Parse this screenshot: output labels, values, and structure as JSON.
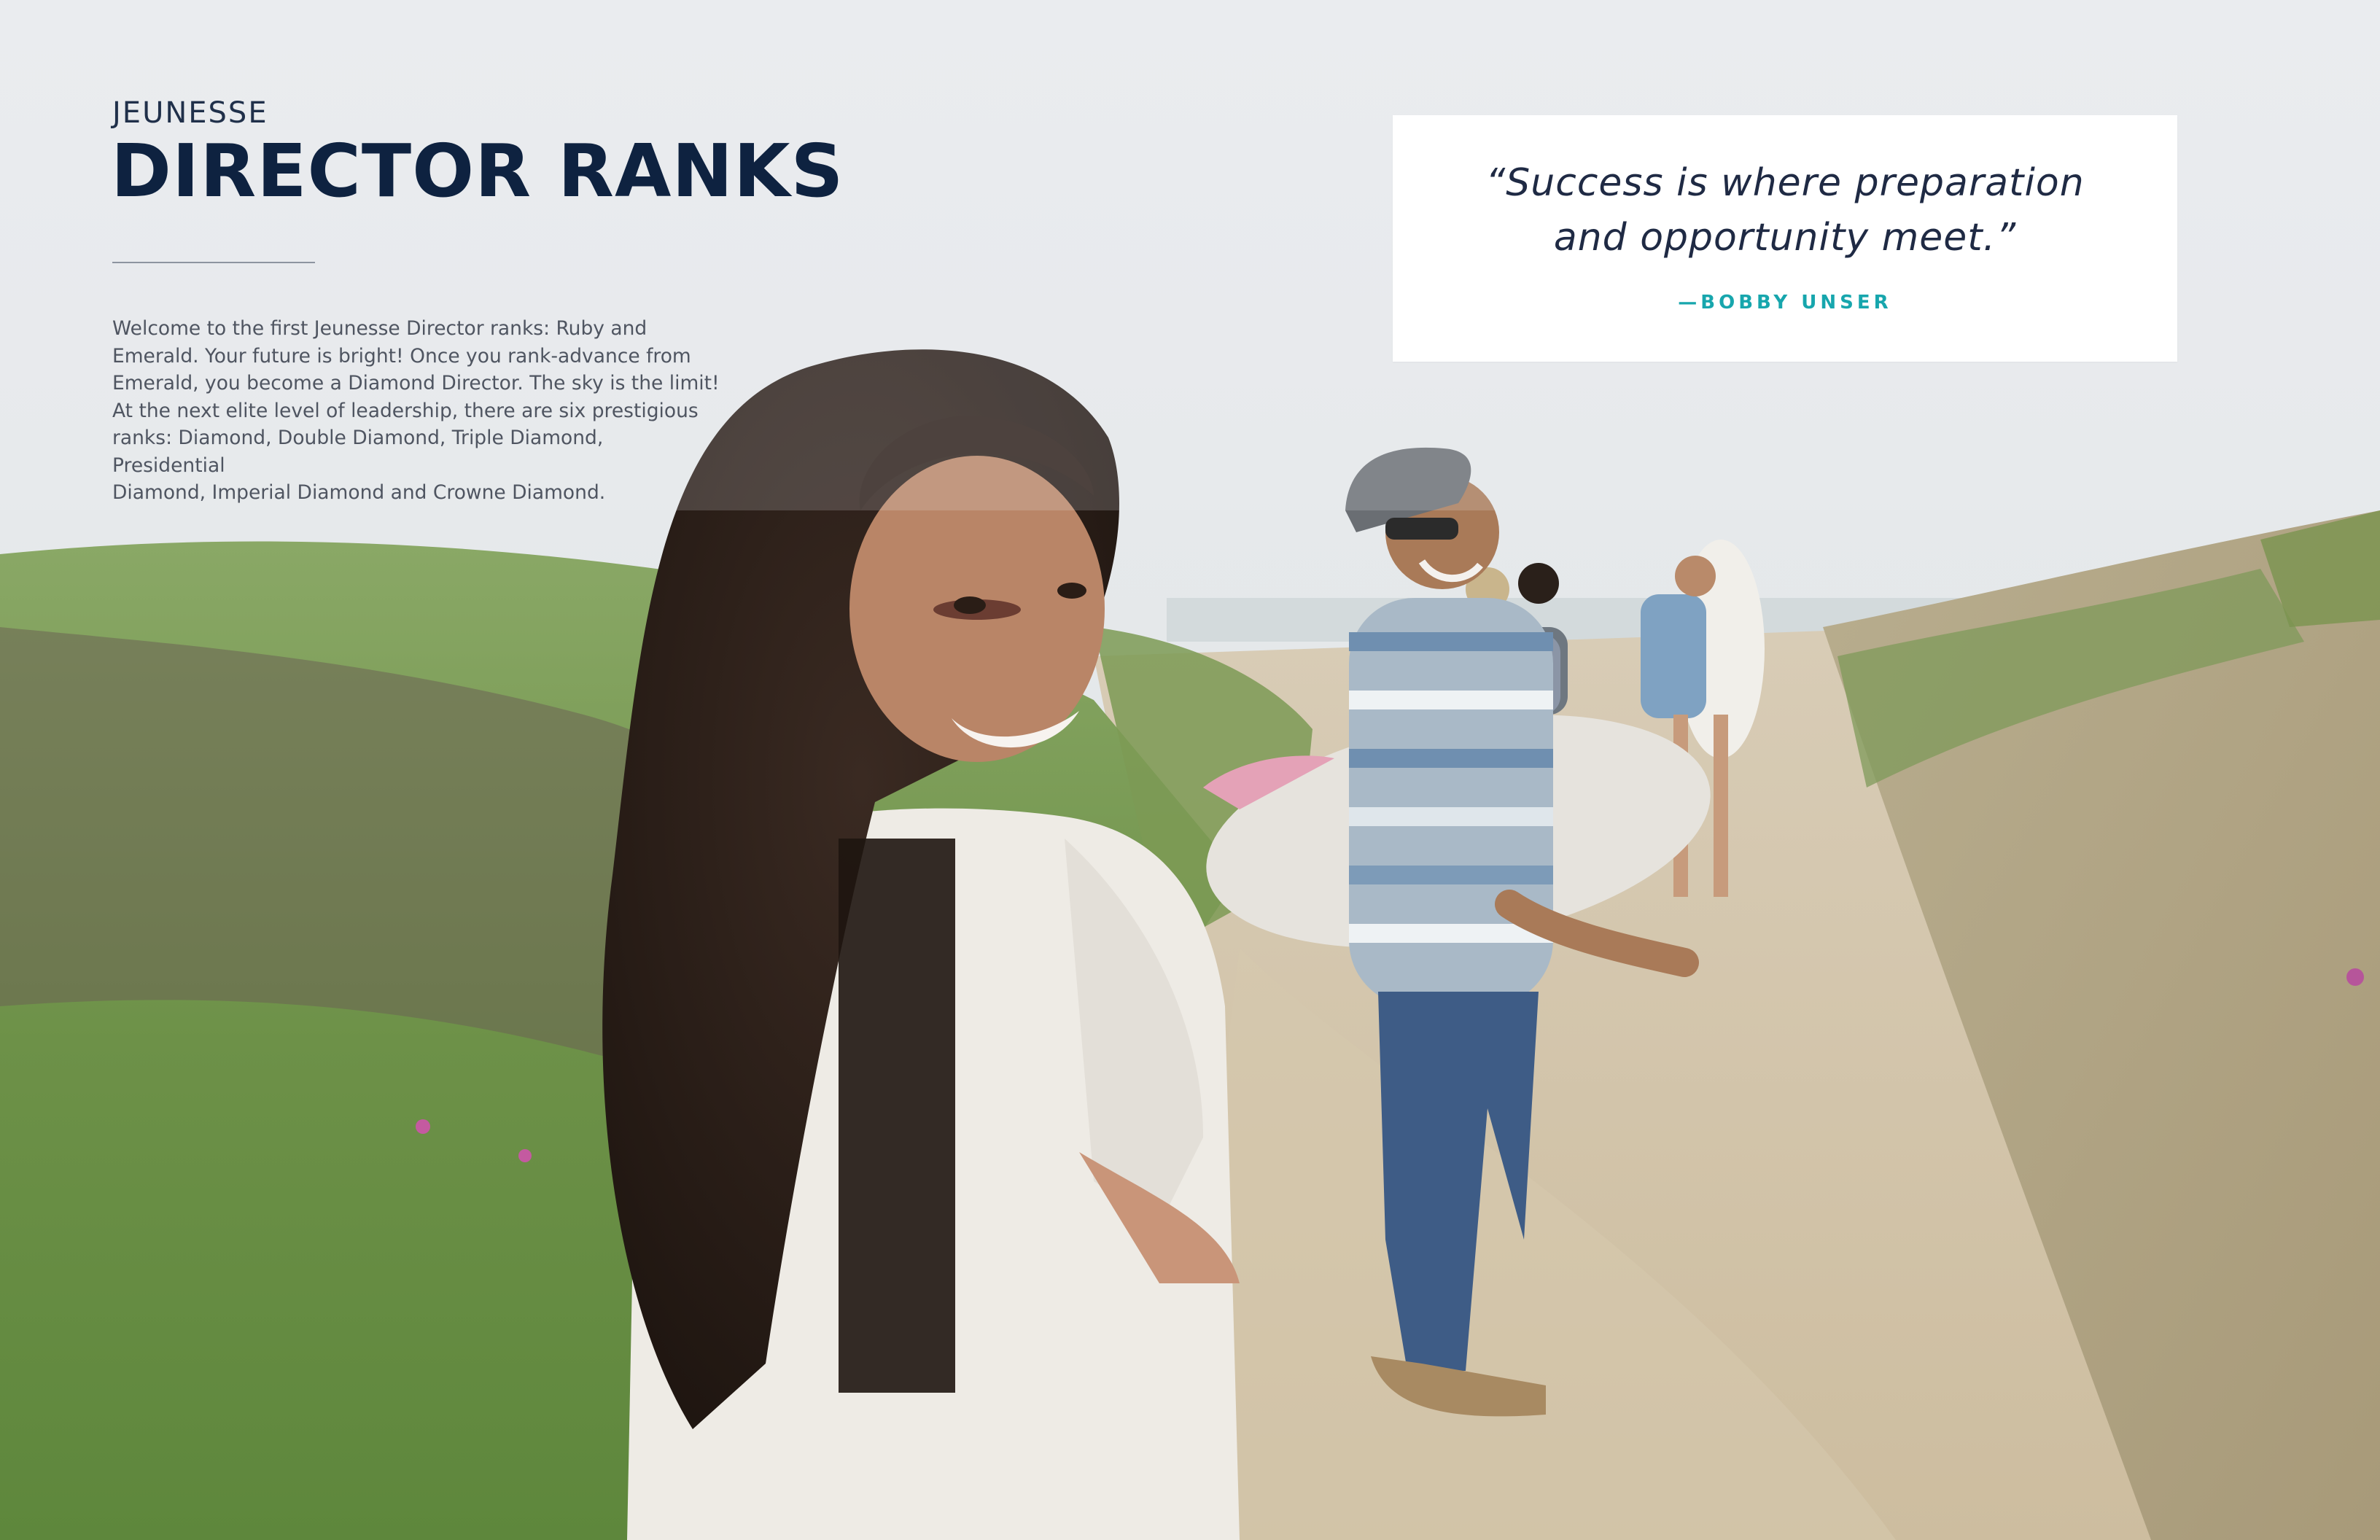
{
  "header": {
    "eyebrow": "JEUNESSE",
    "title": "DIRECTOR RANKS"
  },
  "intro": {
    "line_1": "Welcome to the first Jeunesse Director ranks: Ruby and",
    "line_2": "Emerald. Your future is bright! Once you rank-advance from",
    "line_3": "Emerald, you become a Diamond Director. The sky is the limit!",
    "line_4": "At the next elite level of leadership, there are six prestigious",
    "line_5": "ranks: Diamond, Double Diamond, Triple Diamond, Presidential",
    "line_6": "Diamond, Imperial Diamond and Crowne Diamond."
  },
  "quote": {
    "line_1": "“Success is where preparation",
    "line_2": "and opportunity meet.”",
    "attribution": "—BOBBY UNSER"
  },
  "photo": {
    "subject": "woman-looking-back-icon",
    "scene": "beach-path-with-surfers-icon"
  },
  "colors": {
    "title": "#0e2240",
    "accent": "#17a6ad",
    "body_text": "#4f5561"
  }
}
